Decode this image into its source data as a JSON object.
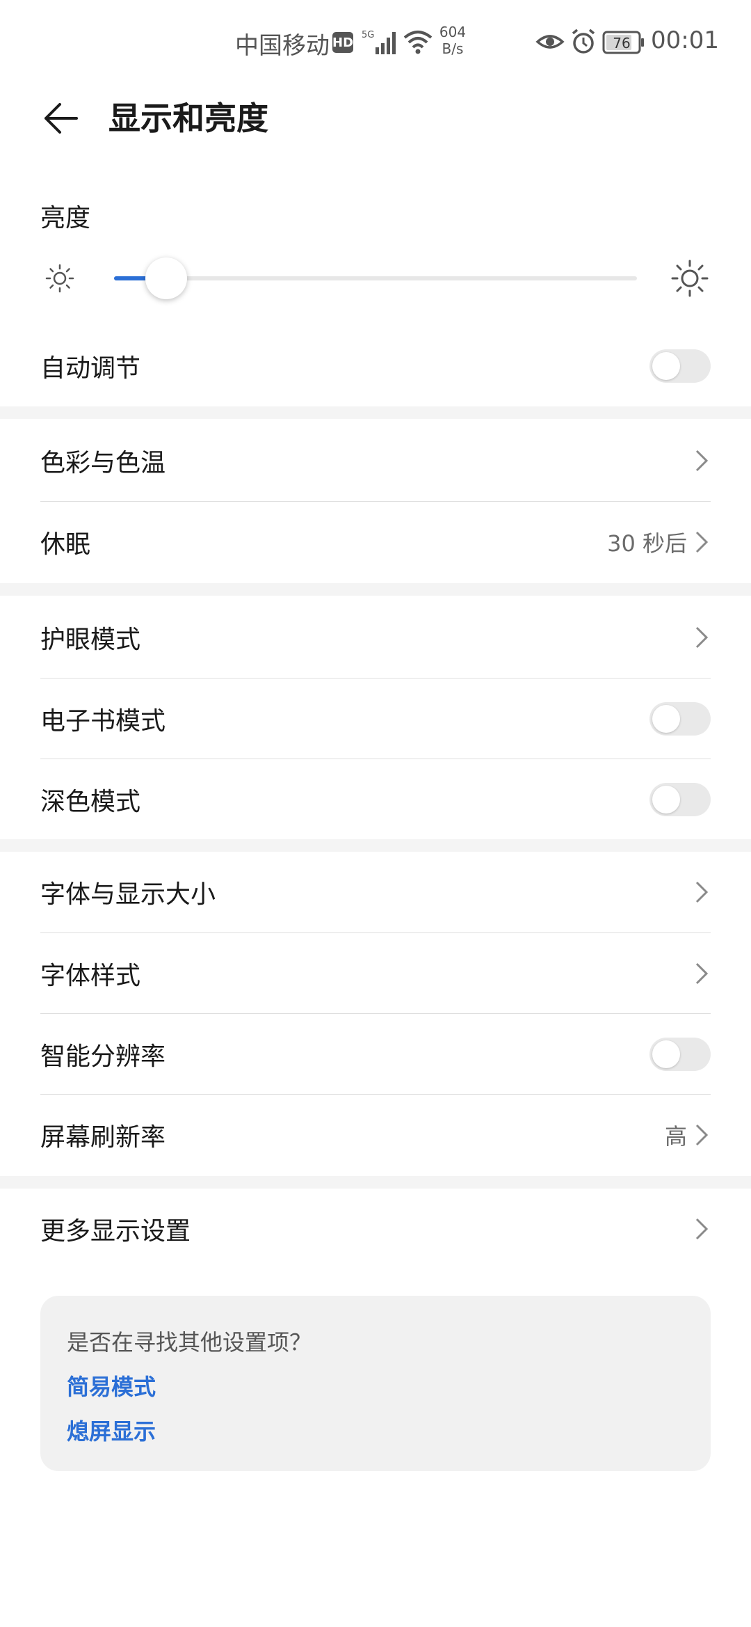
{
  "status_bar": {
    "carrier": "中国移动",
    "hd": "HD",
    "network": "5G",
    "speed_value": "604",
    "speed_unit": "B/s",
    "battery": "76",
    "time": "00:01"
  },
  "header": {
    "title": "显示和亮度"
  },
  "brightness": {
    "label": "亮度",
    "level_fraction": 0.1
  },
  "rows": {
    "auto_adjust": {
      "label": "自动调节",
      "on": false
    },
    "color_temp": {
      "label": "色彩与色温"
    },
    "sleep": {
      "label": "休眠",
      "value": "30 秒后"
    },
    "eye_comfort": {
      "label": "护眼模式"
    },
    "ebook_mode": {
      "label": "电子书模式",
      "on": false
    },
    "dark_mode": {
      "label": "深色模式",
      "on": false
    },
    "font_display_size": {
      "label": "字体与显示大小"
    },
    "font_style": {
      "label": "字体样式"
    },
    "smart_resolution": {
      "label": "智能分辨率",
      "on": false
    },
    "refresh_rate": {
      "label": "屏幕刷新率",
      "value": "高"
    },
    "more_display": {
      "label": "更多显示设置"
    }
  },
  "suggestions": {
    "question": "是否在寻找其他设置项？",
    "links": [
      "简易模式",
      "熄屏显示"
    ]
  },
  "colors": {
    "accent": "#2b6fd6",
    "toggle_off": "#e9e9e9",
    "section_gap": "#f4f4f4"
  }
}
